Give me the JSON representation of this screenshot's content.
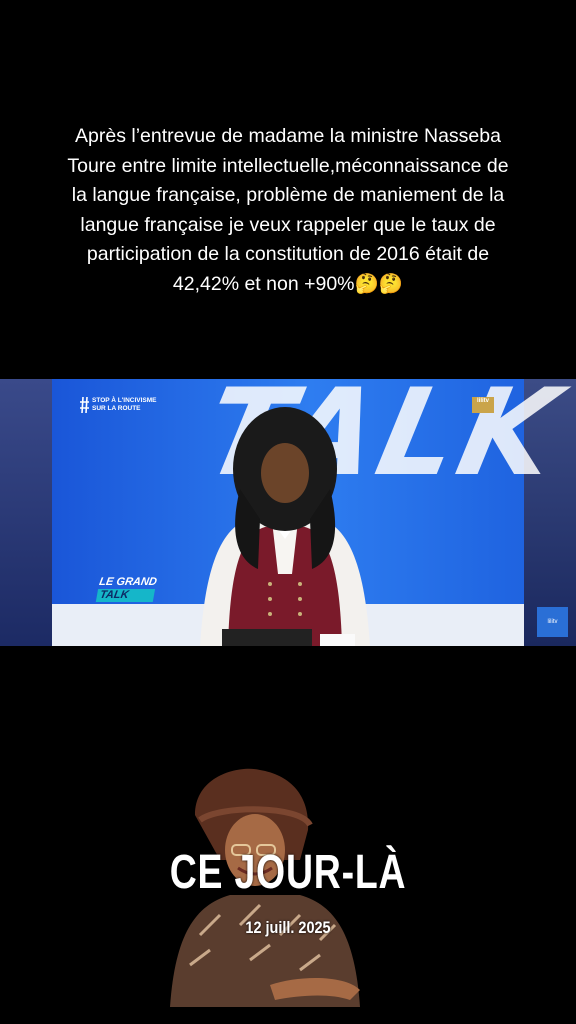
{
  "caption": {
    "lines": [
      "Après l’entrevue de madame la ministre Nasseba",
      "Toure  entre limite intellectuelle,méconnaissance de",
      "la langue française, problème de maniement de la",
      "langue française je veux rappeler que le taux de",
      "participation de la constitution de 2016 était de",
      "42,42% et non +90%🤔🤔"
    ]
  },
  "video": {
    "overlay_text_1": "STOP À L'INCIVISME",
    "overlay_text_2": "SUR LA ROUTE",
    "show_name_1": "LE GRAND",
    "show_name_2": "TALK",
    "studio_backdrop_text": "TALK",
    "channel_logo": "lilitv",
    "accent_color": "#2e7df0"
  },
  "overlay": {
    "title": "CE JOUR-LÀ",
    "date": "12 juill. 2025"
  }
}
